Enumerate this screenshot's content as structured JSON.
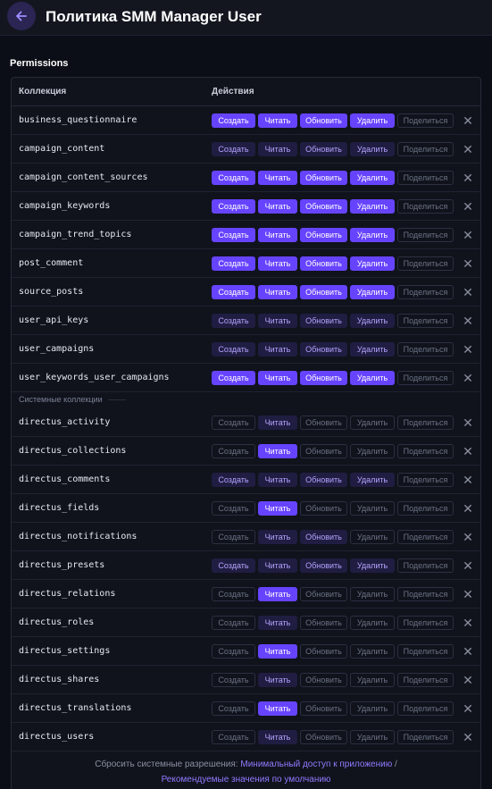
{
  "header": {
    "title": "Политика SMM Manager User",
    "back_icon": "arrow-left-icon"
  },
  "section": {
    "label": "Permissions"
  },
  "table": {
    "col_collection": "Коллекция",
    "col_actions": "Действия",
    "action_labels": {
      "create": "Создать",
      "read": "Читать",
      "update": "Обновить",
      "delete": "Удалить",
      "share": "Поделиться"
    },
    "colors": {
      "full": "#6644ff",
      "custom": "#201d42",
      "none_border": "#2c3041"
    },
    "rows": [
      {
        "name": "business_questionnaire",
        "perms": [
          "full",
          "full",
          "full",
          "full",
          "none"
        ]
      },
      {
        "name": "campaign_content",
        "perms": [
          "custom",
          "custom",
          "custom",
          "custom",
          "none"
        ]
      },
      {
        "name": "campaign_content_sources",
        "perms": [
          "full",
          "full",
          "full",
          "full",
          "none"
        ]
      },
      {
        "name": "campaign_keywords",
        "perms": [
          "full",
          "full",
          "full",
          "full",
          "none"
        ]
      },
      {
        "name": "campaign_trend_topics",
        "perms": [
          "full",
          "full",
          "full",
          "full",
          "none"
        ]
      },
      {
        "name": "post_comment",
        "perms": [
          "full",
          "full",
          "full",
          "full",
          "none"
        ]
      },
      {
        "name": "source_posts",
        "perms": [
          "full",
          "full",
          "full",
          "full",
          "none"
        ]
      },
      {
        "name": "user_api_keys",
        "perms": [
          "custom",
          "custom",
          "custom",
          "custom",
          "none"
        ]
      },
      {
        "name": "user_campaigns",
        "perms": [
          "custom",
          "custom",
          "custom",
          "custom",
          "none"
        ]
      },
      {
        "name": "user_keywords_user_campaigns",
        "perms": [
          "full",
          "full",
          "full",
          "full",
          "none"
        ]
      }
    ],
    "system_divider": "Системные коллекции",
    "system_rows": [
      {
        "name": "directus_activity",
        "perms": [
          "none",
          "custom",
          "none",
          "none",
          "none"
        ]
      },
      {
        "name": "directus_collections",
        "perms": [
          "none",
          "full",
          "none",
          "none",
          "none"
        ]
      },
      {
        "name": "directus_comments",
        "perms": [
          "custom",
          "custom",
          "custom",
          "custom",
          "none"
        ]
      },
      {
        "name": "directus_fields",
        "perms": [
          "none",
          "full",
          "none",
          "none",
          "none"
        ]
      },
      {
        "name": "directus_notifications",
        "perms": [
          "none",
          "custom",
          "custom",
          "none",
          "none"
        ]
      },
      {
        "name": "directus_presets",
        "perms": [
          "custom",
          "custom",
          "custom",
          "custom",
          "none"
        ]
      },
      {
        "name": "directus_relations",
        "perms": [
          "none",
          "full",
          "none",
          "none",
          "none"
        ]
      },
      {
        "name": "directus_roles",
        "perms": [
          "none",
          "custom",
          "none",
          "none",
          "none"
        ]
      },
      {
        "name": "directus_settings",
        "perms": [
          "none",
          "full",
          "none",
          "none",
          "none"
        ]
      },
      {
        "name": "directus_shares",
        "perms": [
          "none",
          "custom",
          "none",
          "none",
          "none"
        ]
      },
      {
        "name": "directus_translations",
        "perms": [
          "none",
          "full",
          "none",
          "none",
          "none"
        ]
      },
      {
        "name": "directus_users",
        "perms": [
          "none",
          "custom",
          "none",
          "none",
          "none"
        ]
      }
    ]
  },
  "footer": {
    "text": "Сбросить системные разрешения:",
    "link_min": "Минимальный доступ к приложению",
    "separator": "/",
    "link_recommended": "Рекомендуемые значения по умолчанию"
  }
}
